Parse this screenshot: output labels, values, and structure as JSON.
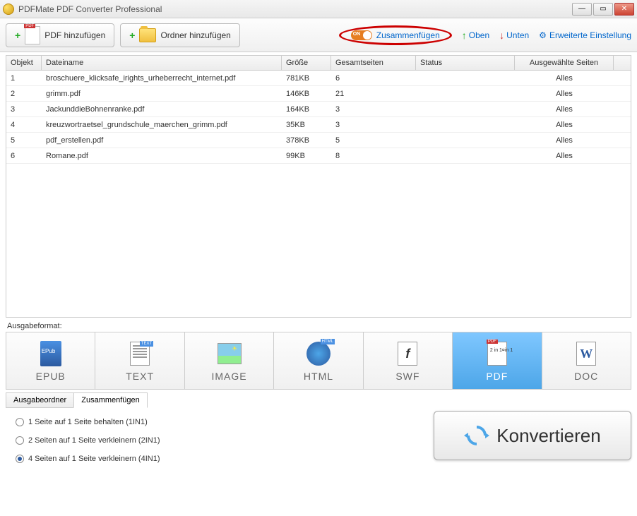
{
  "window": {
    "title": "PDFMate PDF Converter Professional"
  },
  "toolbar": {
    "add_pdf": "PDF hinzufügen",
    "add_folder": "Ordner hinzufügen",
    "merge_toggle_on": "ON",
    "merge_label": "Zusammenfügen",
    "up": "Oben",
    "down": "Unten",
    "settings": "Erweiterte Einstellung"
  },
  "table": {
    "headers": {
      "object": "Objekt",
      "filename": "Dateiname",
      "size": "Größe",
      "pages": "Gesamtseiten",
      "status": "Status",
      "selected": "Ausgewählte Seiten"
    },
    "rows": [
      {
        "idx": "1",
        "name": "broschuere_klicksafe_irights_urheberrecht_internet.pdf",
        "size": "781KB",
        "pages": "6",
        "status": "",
        "sel": "Alles"
      },
      {
        "idx": "2",
        "name": "grimm.pdf",
        "size": "146KB",
        "pages": "21",
        "status": "",
        "sel": "Alles"
      },
      {
        "idx": "3",
        "name": "JackunddieBohnenranke.pdf",
        "size": "164KB",
        "pages": "3",
        "status": "",
        "sel": "Alles"
      },
      {
        "idx": "4",
        "name": "kreuzwortraetsel_grundschule_maerchen_grimm.pdf",
        "size": "35KB",
        "pages": "3",
        "status": "",
        "sel": "Alles"
      },
      {
        "idx": "5",
        "name": "pdf_erstellen.pdf",
        "size": "378KB",
        "pages": "5",
        "status": "",
        "sel": "Alles"
      },
      {
        "idx": "6",
        "name": "Romane.pdf",
        "size": "99KB",
        "pages": "8",
        "status": "",
        "sel": "Alles"
      }
    ]
  },
  "output": {
    "label": "Ausgabeformat:",
    "formats": [
      "EPUB",
      "TEXT",
      "IMAGE",
      "HTML",
      "SWF",
      "PDF",
      "DOC"
    ],
    "selected": "PDF"
  },
  "bottom": {
    "tabs": {
      "folder": "Ausgabeordner",
      "merge": "Zusammenfügen",
      "active": "merge"
    },
    "radios": {
      "r1": "1 Seite auf 1 Seite behalten (1IN1)",
      "r2": "2 Seiten auf 1 Seite verkleinern (2IN1)",
      "r3": "4 Seiten auf 1 Seite verkleinern (4IN1)",
      "selected": "r3"
    },
    "convert": "Konvertieren"
  }
}
